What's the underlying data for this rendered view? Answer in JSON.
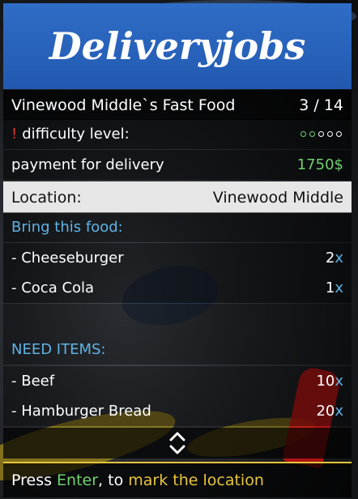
{
  "header": {
    "title": "Deliveryjobs"
  },
  "job": {
    "name": "Vinewood Middle`s Fast Food",
    "progress": "3 / 14",
    "difficulty_warning": "!",
    "difficulty_label": "difficulty level:",
    "difficulty_level": 2,
    "difficulty_max": 5,
    "payment_label": "payment for delivery",
    "payment_value": "1750$"
  },
  "location": {
    "label": "Location:",
    "value": "Vinewood Middle"
  },
  "food": {
    "heading": "Bring this food:",
    "items": [
      {
        "name": "- Cheeseburger",
        "qty": "2",
        "unit": "x"
      },
      {
        "name": "- Coca Cola",
        "qty": "1",
        "unit": "x"
      }
    ]
  },
  "need": {
    "heading": "NEED ITEMS:",
    "items": [
      {
        "name": "- Beef",
        "qty": "10",
        "unit": "x"
      },
      {
        "name": "- Hamburger Bread",
        "qty": "20",
        "unit": "x"
      }
    ]
  },
  "footer": {
    "prefix": "Press ",
    "key": "Enter",
    "middle": ", to ",
    "action": "mark the location"
  },
  "colors": {
    "header_blue": "#2259b0",
    "section_blue": "#5fb3e6",
    "accent_green": "#6fd16f",
    "accent_yellow": "#e8c53a",
    "warning_red": "#e23b3b"
  },
  "icons": {
    "scroll": "up-down-chevron-icon"
  }
}
